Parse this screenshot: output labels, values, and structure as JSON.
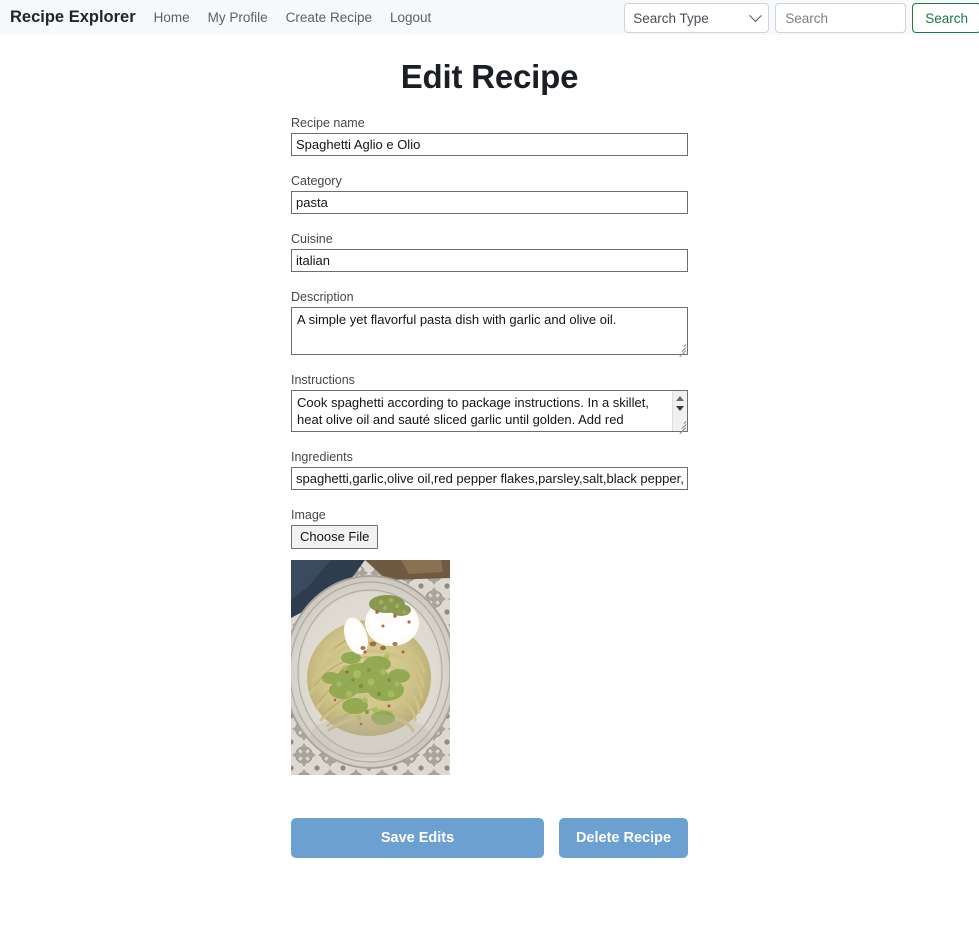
{
  "navbar": {
    "brand": "Recipe Explorer",
    "links": [
      {
        "label": "Home"
      },
      {
        "label": "My Profile"
      },
      {
        "label": "Create Recipe"
      },
      {
        "label": "Logout"
      }
    ],
    "search_type_label": "Search Type",
    "search_placeholder": "Search",
    "search_value": "",
    "search_button": "Search",
    "accent_green": "#1a7a44",
    "background": "#f8f9fa"
  },
  "page": {
    "title": "Edit Recipe"
  },
  "form": {
    "recipe_name": {
      "label": "Recipe name",
      "value": "Spaghetti Aglio e Olio"
    },
    "category": {
      "label": "Category",
      "value": "pasta"
    },
    "cuisine": {
      "label": "Cuisine",
      "value": "italian"
    },
    "description": {
      "label": "Description",
      "value": "A simple yet flavorful pasta dish with garlic and olive oil."
    },
    "instructions": {
      "label": "Instructions",
      "value": "Cook spaghetti according to package instructions. In a skillet, heat olive oil and sauté sliced garlic until golden. Add red pepper"
    },
    "ingredients": {
      "label": "Ingredients",
      "value": "spaghetti,garlic,olive oil,red pepper flakes,parsley,salt,black pepper,pa"
    },
    "image": {
      "label": "Image",
      "choose_file_button": "Choose File",
      "preview_alt": "Plate of spaghetti with green pesto and burrata on a patterned dish"
    }
  },
  "actions": {
    "save_label": "Save Edits",
    "delete_label": "Delete Recipe",
    "button_color": "#6ba0d0"
  }
}
